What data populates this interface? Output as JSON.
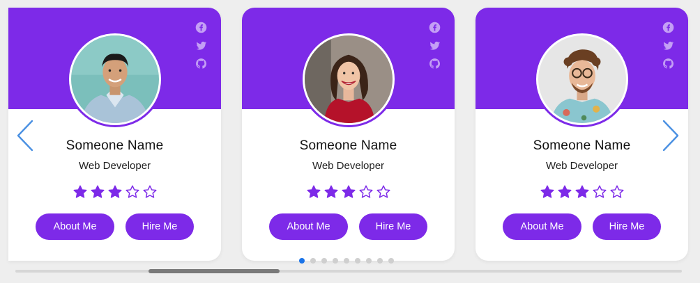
{
  "theme": {
    "accent": "#7d2ae8",
    "arrow": "#4a90e2",
    "dot_active": "#1a73e8",
    "dot_inactive": "#cfcfcf"
  },
  "cards": [
    {
      "name": "Someone Name",
      "job": "Web Developer",
      "rating": 3,
      "rating_max": 5,
      "about_label": "About Me",
      "hire_label": "Hire Me",
      "social": [
        "facebook-icon",
        "twitter-icon",
        "github-icon"
      ],
      "avatar": "young man in light denim shirt against teal wall"
    },
    {
      "name": "Someone Name",
      "job": "Web Developer",
      "rating": 3,
      "rating_max": 5,
      "about_label": "About Me",
      "hire_label": "Hire Me",
      "social": [
        "facebook-icon",
        "twitter-icon",
        "github-icon"
      ],
      "avatar": "smiling woman in red top"
    },
    {
      "name": "Someone Name",
      "job": "Web Developer",
      "rating": 3,
      "rating_max": 5,
      "about_label": "About Me",
      "hire_label": "Hire Me",
      "social": [
        "facebook-icon",
        "twitter-icon",
        "github-icon"
      ],
      "avatar": "curly-haired man with glasses in floral shirt"
    }
  ],
  "navigation": {
    "prev_icon": "chevron-left-icon",
    "next_icon": "chevron-right-icon"
  },
  "pagination": {
    "total": 9,
    "active": 0
  },
  "scrollbar": {
    "position_fraction": 0.2
  }
}
